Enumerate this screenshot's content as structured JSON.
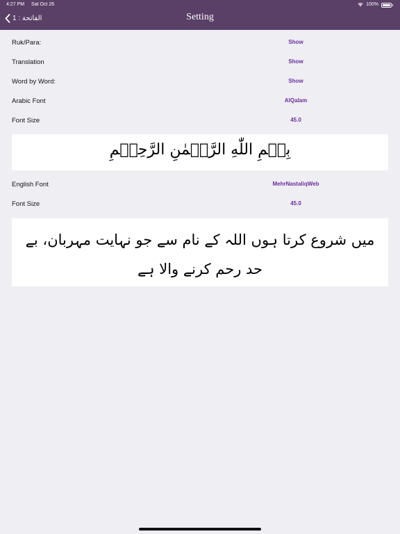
{
  "status_bar": {
    "time": "4:27 PM",
    "date": "Sat Oct 26",
    "battery": "100%"
  },
  "nav": {
    "back_label": "الفاتحة : 1",
    "title": "Setting"
  },
  "settings": {
    "ruk_para": {
      "label": "Ruk/Para:",
      "value": "Show"
    },
    "translation": {
      "label": "Translation",
      "value": "Show"
    },
    "word_by_word": {
      "label": "Word by Word:",
      "value": "Show"
    },
    "arabic_font": {
      "label": "Arabic Font",
      "value": "AlQalam"
    },
    "arabic_font_size": {
      "label": "Font Size",
      "value": "45.0"
    },
    "english_font": {
      "label": "English Font",
      "value": "MehrNastaliqWeb"
    },
    "english_font_size": {
      "label": "Font Size",
      "value": "45.0"
    }
  },
  "preview": {
    "arabic": "بِسۡمِ اللّٰهِ الرَّحۡمٰنِ الرَّحِيۡمِ",
    "urdu": "میں شروع کرتا ہوں اللہ کے نام سے جو نہایت مہربان، بے حد رحم کرنے والا ہے"
  },
  "colors": {
    "nav_bar": "#5a3f67",
    "accent": "#6a2f9c",
    "background": "#efeef3"
  }
}
